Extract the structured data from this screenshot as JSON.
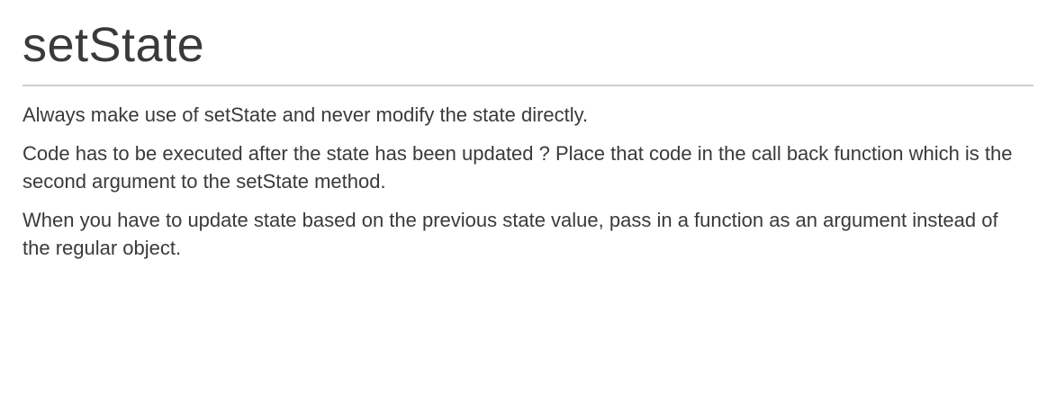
{
  "slide": {
    "title": "setState",
    "paragraphs": [
      "Always make use of setState and never modify the state directly.",
      "Code has to be executed after the state has been updated ? Place that code in the call back function which is the second argument to the setState method.",
      "When you have to update state based on the previous state value, pass in a function as an argument instead of the regular object."
    ]
  }
}
